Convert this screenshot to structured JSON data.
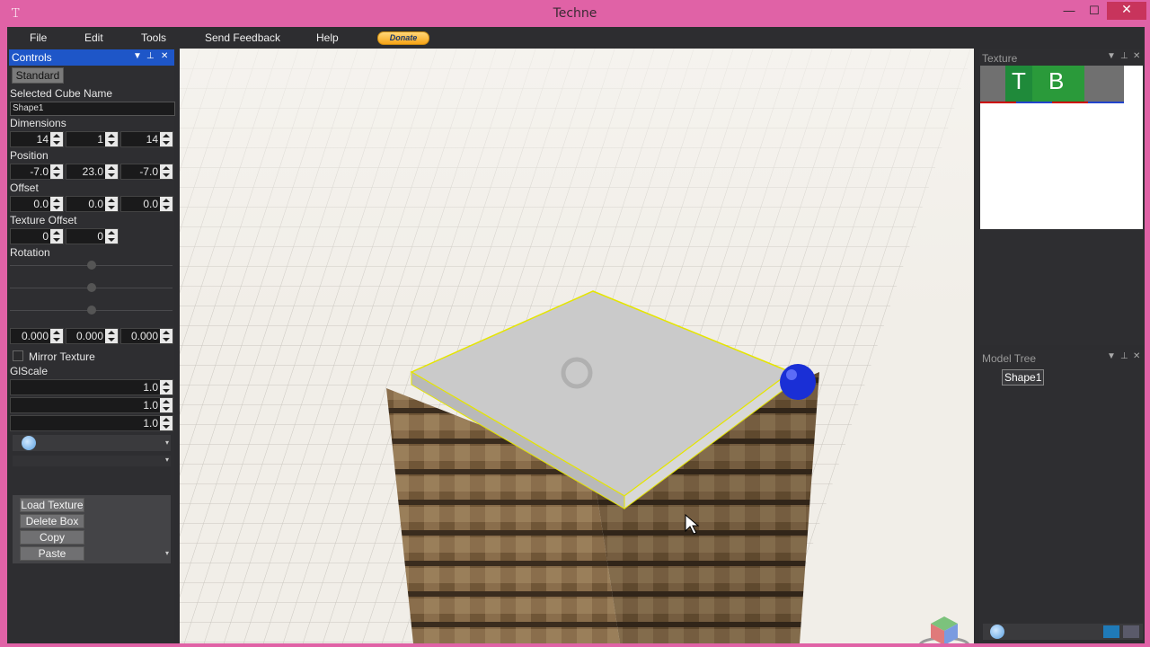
{
  "window": {
    "title": "Techne",
    "minimize": "—",
    "maximize": "☐",
    "close": "✕"
  },
  "menu": {
    "file": "File",
    "edit": "Edit",
    "tools": "Tools",
    "feedback": "Send Feedback",
    "help": "Help",
    "donate": "Donate"
  },
  "controls": {
    "header": "Controls",
    "standard_button": "Standard",
    "selected_cube_name_label": "Selected Cube Name",
    "selected_cube_name": "Shape1",
    "dimensions_label": "Dimensions",
    "dimensions": [
      "14",
      "1",
      "14"
    ],
    "position_label": "Position",
    "position": [
      "-7.0",
      "23.0",
      "-7.0"
    ],
    "offset_label": "Offset",
    "offset": [
      "0.0",
      "0.0",
      "0.0"
    ],
    "texture_offset_label": "Texture Offset",
    "texture_offset": [
      "0",
      "0"
    ],
    "rotation_label": "Rotation",
    "rotation": [
      "0.000",
      "0.000",
      "0.000"
    ],
    "mirror_texture_label": "Mirror Texture",
    "glscale_label": "GlScale",
    "glscale": [
      "1.0",
      "1.0",
      "1.0"
    ],
    "buttons": {
      "load_texture": "Load Texture",
      "delete_box": "Delete Box",
      "copy": "Copy",
      "paste": "Paste"
    }
  },
  "texture_panel": {
    "header": "Texture",
    "t_label": "T",
    "b_label": "B"
  },
  "model_tree": {
    "header": "Model Tree",
    "items": [
      "Shape1"
    ]
  }
}
